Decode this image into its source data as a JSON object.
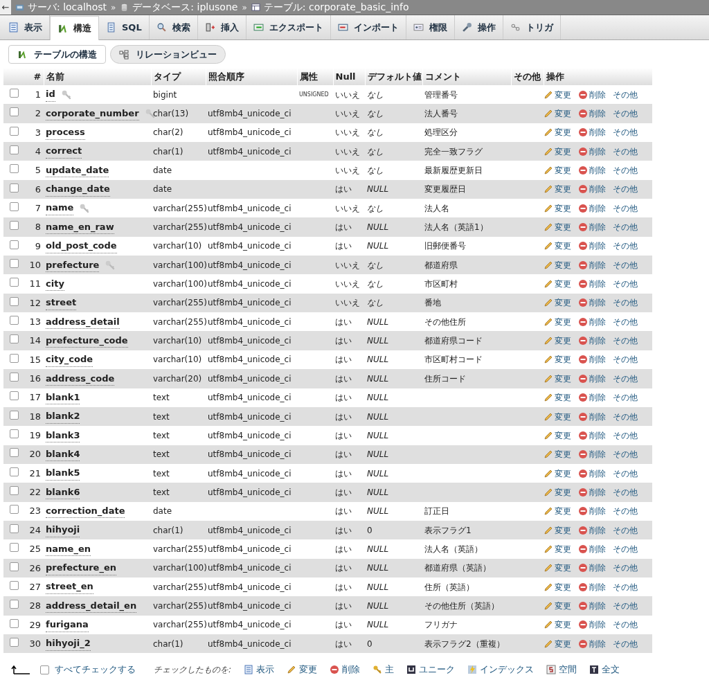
{
  "breadcrumb": [
    "サーバ: localhost",
    "データベース: iplusone",
    "テーブル: corporate_basic_info"
  ],
  "breadcrumb_separators": [
    "»",
    "»"
  ],
  "back_arrow": "←",
  "tabs": [
    {
      "label": "表示",
      "selected": false
    },
    {
      "label": "構造",
      "selected": true
    },
    {
      "label": "SQL",
      "selected": false
    },
    {
      "label": "検索",
      "selected": false
    },
    {
      "label": "挿入",
      "selected": false
    },
    {
      "label": "エクスポート",
      "selected": false
    },
    {
      "label": "インポート",
      "selected": false
    },
    {
      "label": "権限",
      "selected": false
    },
    {
      "label": "操作",
      "selected": false
    },
    {
      "label": "トリガ",
      "selected": false
    }
  ],
  "subtabs": [
    {
      "label": "テーブルの構造",
      "selected": true
    },
    {
      "label": "リレーションビュー",
      "selected": false
    }
  ],
  "columns": [
    "#",
    "名前",
    "タイプ",
    "照合順序",
    "属性",
    "Null",
    "デフォルト値",
    "コメント",
    "その他",
    "操作"
  ],
  "rows": [
    {
      "num": "1",
      "name": "id",
      "key": true,
      "type": "bigint",
      "collation": "",
      "attribute": "UNSIGNED",
      "null": "いいえ",
      "default": "なし",
      "default_keyword": true,
      "comment": "管理番号",
      "checked": false,
      "actions": [
        "変更",
        "削除",
        "その他"
      ]
    },
    {
      "num": "2",
      "name": "corporate_number",
      "key": true,
      "type": "char(13)",
      "collation": "utf8mb4_unicode_ci",
      "attribute": "",
      "null": "いいえ",
      "default": "なし",
      "default_keyword": true,
      "comment": "法人番号",
      "checked": false,
      "actions": [
        "変更",
        "削除",
        "その他"
      ]
    },
    {
      "num": "3",
      "name": "process",
      "key": false,
      "type": "char(2)",
      "collation": "utf8mb4_unicode_ci",
      "attribute": "",
      "null": "いいえ",
      "default": "なし",
      "default_keyword": true,
      "comment": "処理区分",
      "checked": false,
      "actions": [
        "変更",
        "削除",
        "その他"
      ]
    },
    {
      "num": "4",
      "name": "correct",
      "key": false,
      "type": "char(1)",
      "collation": "utf8mb4_unicode_ci",
      "attribute": "",
      "null": "いいえ",
      "default": "なし",
      "default_keyword": true,
      "comment": "完全一致フラグ",
      "checked": false,
      "actions": [
        "変更",
        "削除",
        "その他"
      ]
    },
    {
      "num": "5",
      "name": "update_date",
      "key": false,
      "type": "date",
      "collation": "",
      "attribute": "",
      "null": "いいえ",
      "default": "なし",
      "default_keyword": true,
      "comment": "最新履歴更新日",
      "checked": false,
      "actions": [
        "変更",
        "削除",
        "その他"
      ]
    },
    {
      "num": "6",
      "name": "change_date",
      "key": false,
      "type": "date",
      "collation": "",
      "attribute": "",
      "null": "はい",
      "default": "NULL",
      "default_keyword": true,
      "comment": "変更履歴日",
      "checked": false,
      "actions": [
        "変更",
        "削除",
        "その他"
      ]
    },
    {
      "num": "7",
      "name": "name",
      "key": true,
      "type": "varchar(255)",
      "collation": "utf8mb4_unicode_ci",
      "attribute": "",
      "null": "いいえ",
      "default": "なし",
      "default_keyword": true,
      "comment": "法人名",
      "checked": false,
      "actions": [
        "変更",
        "削除",
        "その他"
      ]
    },
    {
      "num": "8",
      "name": "name_en_raw",
      "key": false,
      "type": "varchar(255)",
      "collation": "utf8mb4_unicode_ci",
      "attribute": "",
      "null": "はい",
      "default": "NULL",
      "default_keyword": true,
      "comment": "法人名（英語1）",
      "checked": false,
      "actions": [
        "変更",
        "削除",
        "その他"
      ]
    },
    {
      "num": "9",
      "name": "old_post_code",
      "key": false,
      "type": "varchar(10)",
      "collation": "utf8mb4_unicode_ci",
      "attribute": "",
      "null": "はい",
      "default": "NULL",
      "default_keyword": true,
      "comment": "旧郵便番号",
      "checked": false,
      "actions": [
        "変更",
        "削除",
        "その他"
      ]
    },
    {
      "num": "10",
      "name": "prefecture",
      "key": true,
      "type": "varchar(100)",
      "collation": "utf8mb4_unicode_ci",
      "attribute": "",
      "null": "いいえ",
      "default": "なし",
      "default_keyword": true,
      "comment": "都道府県",
      "checked": false,
      "actions": [
        "変更",
        "削除",
        "その他"
      ]
    },
    {
      "num": "11",
      "name": "city",
      "key": false,
      "type": "varchar(100)",
      "collation": "utf8mb4_unicode_ci",
      "attribute": "",
      "null": "いいえ",
      "default": "なし",
      "default_keyword": true,
      "comment": "市区町村",
      "checked": false,
      "actions": [
        "変更",
        "削除",
        "その他"
      ]
    },
    {
      "num": "12",
      "name": "street",
      "key": false,
      "type": "varchar(255)",
      "collation": "utf8mb4_unicode_ci",
      "attribute": "",
      "null": "いいえ",
      "default": "なし",
      "default_keyword": true,
      "comment": "番地",
      "checked": false,
      "actions": [
        "変更",
        "削除",
        "その他"
      ]
    },
    {
      "num": "13",
      "name": "address_detail",
      "key": false,
      "type": "varchar(255)",
      "collation": "utf8mb4_unicode_ci",
      "attribute": "",
      "null": "はい",
      "default": "NULL",
      "default_keyword": true,
      "comment": "その他住所",
      "checked": false,
      "actions": [
        "変更",
        "削除",
        "その他"
      ]
    },
    {
      "num": "14",
      "name": "prefecture_code",
      "key": false,
      "type": "varchar(10)",
      "collation": "utf8mb4_unicode_ci",
      "attribute": "",
      "null": "はい",
      "default": "NULL",
      "default_keyword": true,
      "comment": "都道府県コード",
      "checked": false,
      "actions": [
        "変更",
        "削除",
        "その他"
      ]
    },
    {
      "num": "15",
      "name": "city_code",
      "key": false,
      "type": "varchar(10)",
      "collation": "utf8mb4_unicode_ci",
      "attribute": "",
      "null": "はい",
      "default": "NULL",
      "default_keyword": true,
      "comment": "市区町村コード",
      "checked": false,
      "actions": [
        "変更",
        "削除",
        "その他"
      ]
    },
    {
      "num": "16",
      "name": "address_code",
      "key": false,
      "type": "varchar(20)",
      "collation": "utf8mb4_unicode_ci",
      "attribute": "",
      "null": "はい",
      "default": "NULL",
      "default_keyword": true,
      "comment": "住所コード",
      "checked": false,
      "actions": [
        "変更",
        "削除",
        "その他"
      ]
    },
    {
      "num": "17",
      "name": "blank1",
      "key": false,
      "type": "text",
      "collation": "utf8mb4_unicode_ci",
      "attribute": "",
      "null": "はい",
      "default": "NULL",
      "default_keyword": true,
      "comment": "",
      "checked": false,
      "actions": [
        "変更",
        "削除",
        "その他"
      ]
    },
    {
      "num": "18",
      "name": "blank2",
      "key": false,
      "type": "text",
      "collation": "utf8mb4_unicode_ci",
      "attribute": "",
      "null": "はい",
      "default": "NULL",
      "default_keyword": true,
      "comment": "",
      "checked": false,
      "actions": [
        "変更",
        "削除",
        "その他"
      ]
    },
    {
      "num": "19",
      "name": "blank3",
      "key": false,
      "type": "text",
      "collation": "utf8mb4_unicode_ci",
      "attribute": "",
      "null": "はい",
      "default": "NULL",
      "default_keyword": true,
      "comment": "",
      "checked": false,
      "actions": [
        "変更",
        "削除",
        "その他"
      ]
    },
    {
      "num": "20",
      "name": "blank4",
      "key": false,
      "type": "text",
      "collation": "utf8mb4_unicode_ci",
      "attribute": "",
      "null": "はい",
      "default": "NULL",
      "default_keyword": true,
      "comment": "",
      "checked": false,
      "actions": [
        "変更",
        "削除",
        "その他"
      ]
    },
    {
      "num": "21",
      "name": "blank5",
      "key": false,
      "type": "text",
      "collation": "utf8mb4_unicode_ci",
      "attribute": "",
      "null": "はい",
      "default": "NULL",
      "default_keyword": true,
      "comment": "",
      "checked": false,
      "actions": [
        "変更",
        "削除",
        "その他"
      ]
    },
    {
      "num": "22",
      "name": "blank6",
      "key": false,
      "type": "text",
      "collation": "utf8mb4_unicode_ci",
      "attribute": "",
      "null": "はい",
      "default": "NULL",
      "default_keyword": true,
      "comment": "",
      "checked": false,
      "actions": [
        "変更",
        "削除",
        "その他"
      ]
    },
    {
      "num": "23",
      "name": "correction_date",
      "key": false,
      "type": "date",
      "collation": "",
      "attribute": "",
      "null": "はい",
      "default": "NULL",
      "default_keyword": true,
      "comment": "訂正日",
      "checked": false,
      "actions": [
        "変更",
        "削除",
        "その他"
      ]
    },
    {
      "num": "24",
      "name": "hihyoji",
      "key": false,
      "type": "char(1)",
      "collation": "utf8mb4_unicode_ci",
      "attribute": "",
      "null": "はい",
      "default": "0",
      "default_keyword": false,
      "comment": "表示フラグ1",
      "checked": false,
      "actions": [
        "変更",
        "削除",
        "その他"
      ]
    },
    {
      "num": "25",
      "name": "name_en",
      "key": false,
      "type": "varchar(255)",
      "collation": "utf8mb4_unicode_ci",
      "attribute": "",
      "null": "はい",
      "default": "NULL",
      "default_keyword": true,
      "comment": "法人名（英語）",
      "checked": false,
      "actions": [
        "変更",
        "削除",
        "その他"
      ]
    },
    {
      "num": "26",
      "name": "prefecture_en",
      "key": false,
      "type": "varchar(100)",
      "collation": "utf8mb4_unicode_ci",
      "attribute": "",
      "null": "はい",
      "default": "NULL",
      "default_keyword": true,
      "comment": "都道府県（英語）",
      "checked": false,
      "actions": [
        "変更",
        "削除",
        "その他"
      ]
    },
    {
      "num": "27",
      "name": "street_en",
      "key": false,
      "type": "varchar(255)",
      "collation": "utf8mb4_unicode_ci",
      "attribute": "",
      "null": "はい",
      "default": "NULL",
      "default_keyword": true,
      "comment": "住所（英語）",
      "checked": false,
      "actions": [
        "変更",
        "削除",
        "その他"
      ]
    },
    {
      "num": "28",
      "name": "address_detail_en",
      "key": false,
      "type": "varchar(255)",
      "collation": "utf8mb4_unicode_ci",
      "attribute": "",
      "null": "はい",
      "default": "NULL",
      "default_keyword": true,
      "comment": "その他住所（英語）",
      "checked": false,
      "actions": [
        "変更",
        "削除",
        "その他"
      ]
    },
    {
      "num": "29",
      "name": "furigana",
      "key": false,
      "type": "varchar(255)",
      "collation": "utf8mb4_unicode_ci",
      "attribute": "",
      "null": "はい",
      "default": "NULL",
      "default_keyword": true,
      "comment": "フリガナ",
      "checked": false,
      "actions": [
        "変更",
        "削除",
        "その他"
      ]
    },
    {
      "num": "30",
      "name": "hihyoji_2",
      "key": false,
      "type": "char(1)",
      "collation": "utf8mb4_unicode_ci",
      "attribute": "",
      "null": "はい",
      "default": "0",
      "default_keyword": false,
      "comment": "表示フラグ2（重複）",
      "checked": false,
      "actions": [
        "変更",
        "削除",
        "その他"
      ]
    }
  ],
  "footer": {
    "check_all": {
      "label": "すべてチェックする",
      "checked": false
    },
    "with_selected": "チェックしたものを:",
    "actions": [
      "表示",
      "変更",
      "削除",
      "主",
      "ユニーク",
      "インデックス",
      "空間",
      "全文"
    ]
  }
}
